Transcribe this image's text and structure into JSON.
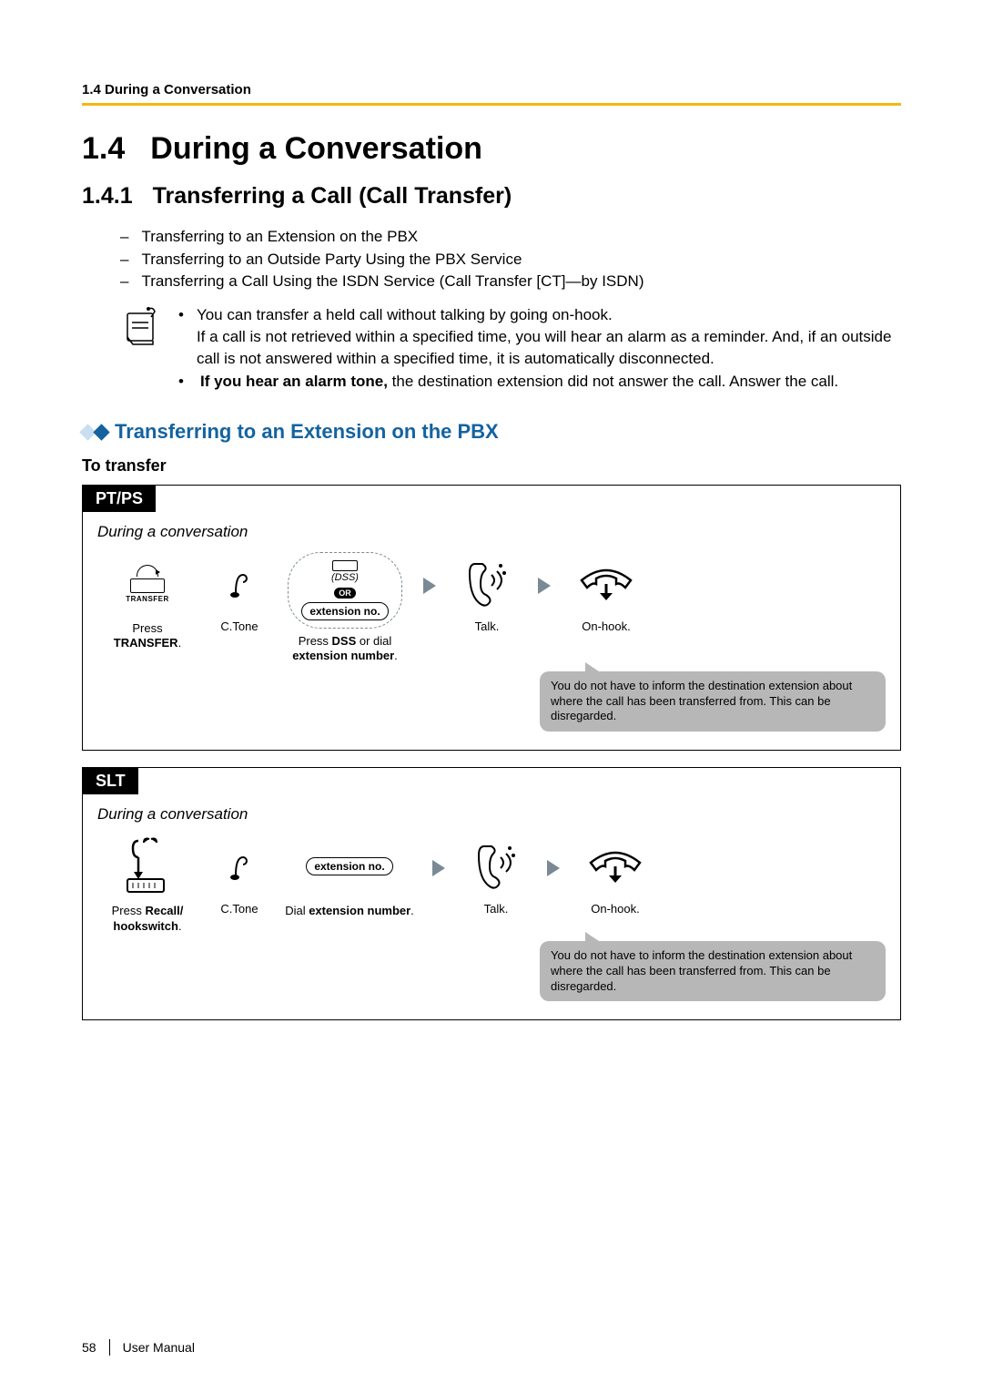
{
  "header": {
    "running": "1.4 During a Conversation"
  },
  "section": {
    "num": "1.4",
    "title": "During a Conversation"
  },
  "subsection": {
    "num": "1.4.1",
    "title": "Transferring a Call (Call Transfer)"
  },
  "dash_items": [
    "Transferring to an Extension on the PBX",
    "Transferring to an Outside Party Using the PBX Service",
    "Transferring a Call Using the ISDN Service (Call Transfer [CT]—by ISDN)"
  ],
  "notes": {
    "b1a": "You can transfer a held call without talking by going on-hook.",
    "b1b": "If a call is not retrieved within a specified time, you will hear an alarm as a reminder. And, if an outside call is not answered within a specified time, it is automatically disconnected.",
    "b2_bold": "If you hear an alarm tone,",
    "b2_rest": " the destination extension did not answer the call. Answer the call."
  },
  "blue_heading": "Transferring to an Extension on the PBX",
  "to_transfer": "To transfer",
  "ptps": {
    "tab": "PT/PS",
    "context": "During a conversation",
    "transfer_label": "TRANSFER",
    "step1_cap_a": "Press ",
    "step1_cap_b": "TRANSFER",
    "step1_cap_c": ".",
    "ctone": "C.Tone",
    "dss": "(DSS)",
    "or": "OR",
    "ext_pill": "extension no.",
    "step2_cap_a": "Press ",
    "step2_cap_b": "DSS",
    "step2_cap_c": " or dial ",
    "step2_cap_d": "extension number",
    "step2_cap_e": ".",
    "talk": "Talk.",
    "onhook": "On-hook.",
    "speech": "You do not have to inform the destination extension about where the call has been transferred from. This can be disregarded."
  },
  "slt": {
    "tab": "SLT",
    "context": "During a conversation",
    "step1_cap_a": "Press ",
    "step1_cap_b": "Recall/",
    "step1_cap_c": "hookswitch",
    "step1_cap_d": ".",
    "ctone": "C.Tone",
    "ext_pill": "extension no.",
    "step2_cap_a": "Dial ",
    "step2_cap_b": "extension number",
    "step2_cap_c": ".",
    "talk": "Talk.",
    "onhook": "On-hook.",
    "speech": "You do not have to inform the destination extension about where the call has been transferred from. This can be disregarded."
  },
  "footer": {
    "page": "58",
    "doc": "User Manual"
  }
}
